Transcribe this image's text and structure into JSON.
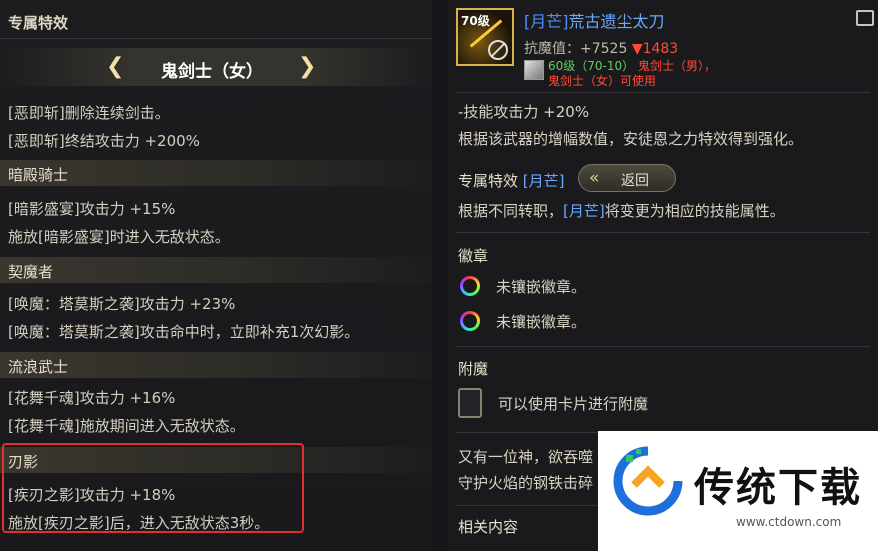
{
  "left_panel": {
    "title": "专属特效",
    "selector": {
      "prev_icon": "chevron-left-icon",
      "class_name": "鬼剑士（女）",
      "next_icon": "chevron-right-icon"
    },
    "lines_top": [
      "[恶即斩]删除连续剑击。",
      "[恶即斩]终结攻击力 +200%"
    ],
    "sections": [
      {
        "name": "暗殿骑士",
        "lines": [
          "[暗影盛宴]攻击力 +15%",
          "施放[暗影盛宴]时进入无敌状态。"
        ]
      },
      {
        "name": "契魔者",
        "lines": [
          "[唤魔：塔莫斯之袭]攻击力 +23%",
          "[唤魔：塔莫斯之袭]攻击命中时，立即补充1次幻影。"
        ]
      },
      {
        "name": "流浪武士",
        "lines": [
          "[花舞千魂]攻击力 +16%",
          "[花舞千魂]施放期间进入无敌状态。"
        ]
      },
      {
        "name": "刃影",
        "lines": [
          "[疾刃之影]攻击力 +18%",
          "施放[疾刃之影]后，进入无敌状态3秒。"
        ]
      }
    ],
    "highlight_color": "#e03030"
  },
  "right_panel": {
    "item": {
      "level_badge": "70级",
      "name_bracket": "[月芒]",
      "name": "荒古遗尘太刀",
      "stat_label": "抗魔值：+7525",
      "stat_change": "▼1483",
      "req_level": "60级（70-10）",
      "req_class_1": "鬼剑士（男），",
      "req_class_2": "鬼剑士（女）可使用"
    },
    "skill_line": "-技能攻击力 +20%",
    "skill_desc": "根据该武器的增幅数值，安徒恩之力特效得到强化。",
    "exclusive": {
      "label": "专属特效",
      "tag": "[月芒]",
      "return_label": "返回",
      "desc_pre": "根据不同转职，",
      "desc_tag": "[月芒]",
      "desc_post": "将变更为相应的技能属性。"
    },
    "emblem": {
      "title": "徽章",
      "slots": [
        "未镶嵌徽章。",
        "未镶嵌徽章。"
      ]
    },
    "enchant": {
      "title": "附魔",
      "desc": "可以使用卡片进行附魔"
    },
    "lore_1": "又有一位神，欲吞噬",
    "lore_2": "守护火焰的钢铁击碎",
    "related": "相关内容"
  },
  "watermark": {
    "title": "传统下载",
    "url": "www.ctdown.com"
  },
  "colors": {
    "accent_blue": "#6aa7ff",
    "red": "#ff4a3a",
    "green": "#5cd05c",
    "gold": "#d7b34a"
  }
}
